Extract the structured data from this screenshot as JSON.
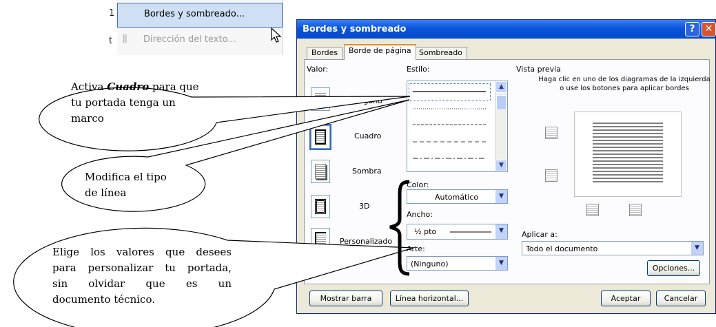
{
  "menu": {
    "edge_chars": [
      "1",
      "t"
    ],
    "items": [
      {
        "label": "Bordes y sombreado...",
        "state": "highlighted"
      },
      {
        "label": "Dirección del texto...",
        "state": "disabled"
      }
    ]
  },
  "dialog": {
    "title": "Bordes y sombreado",
    "tabs": [
      "Bordes",
      "Borde de página",
      "Sombreado"
    ],
    "active_tab": "Borde de página",
    "setting_label": "Valor:",
    "settings": [
      "Ninguno",
      "Cuadro",
      "Sombra",
      "3D",
      "Personalizado"
    ],
    "selected_setting": "Cuadro",
    "style_label": "Estilo:",
    "color_label": "Color:",
    "color_value": "Automático",
    "width_label": "Ancho:",
    "width_value": "½ pto",
    "art_label": "Arte:",
    "art_value": "(Ninguno)",
    "preview_label": "Vista previa",
    "preview_instructions": "Haga clic en uno de los diagramas de la izquierda o use los botones para aplicar bordes",
    "apply_label": "Aplicar a:",
    "apply_value": "Todo el documento",
    "options_button": "Opciones...",
    "toolbar_button": "Mostrar barra",
    "hline_button": "Línea horizontal...",
    "ok_button": "Aceptar",
    "cancel_button": "Cancelar"
  },
  "callouts": {
    "c1_prefix": "Activa ",
    "c1_emphasis": "Cuadro",
    "c1_rest_line1": " para que",
    "c1_line2": "tu portada tenga un",
    "c1_line3": "marco",
    "c2_line1": "Modifica el tipo",
    "c2_line2": "de línea",
    "c3_line1": "Elige los valores que desees",
    "c3_line2": "para personalizar tu  portada,",
    "c3_line3": "sin    olvidar    que    es    un",
    "c3_line4": "documento técnico."
  },
  "colors": {
    "title_bar": "#0a54d9",
    "dialog_bg": "#ece9d8",
    "menu_highlight": "#cfe0f5",
    "tab_accent": "#e68b2c"
  }
}
